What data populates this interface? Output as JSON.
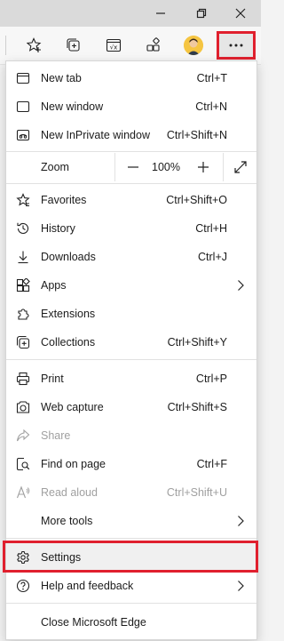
{
  "window": {
    "minimize_icon": "minimize-icon",
    "restore_icon": "restore-icon",
    "close_icon": "close-icon"
  },
  "toolbar": {
    "buttons": [
      "add-favorite-icon",
      "collections-icon",
      "math-solver-icon",
      "extensions-icon",
      "profile-avatar",
      "more-icon"
    ],
    "math_label": "√x"
  },
  "menu": {
    "new_tab": {
      "label": "New tab",
      "shortcut": "Ctrl+T"
    },
    "new_window": {
      "label": "New window",
      "shortcut": "Ctrl+N"
    },
    "new_inprivate": {
      "label": "New InPrivate window",
      "shortcut": "Ctrl+Shift+N"
    },
    "zoom": {
      "label": "Zoom",
      "value": "100%",
      "minus": "—",
      "plus": "+"
    },
    "favorites": {
      "label": "Favorites",
      "shortcut": "Ctrl+Shift+O"
    },
    "history": {
      "label": "History",
      "shortcut": "Ctrl+H"
    },
    "downloads": {
      "label": "Downloads",
      "shortcut": "Ctrl+J"
    },
    "apps": {
      "label": "Apps"
    },
    "extensions": {
      "label": "Extensions"
    },
    "collections": {
      "label": "Collections",
      "shortcut": "Ctrl+Shift+Y"
    },
    "print": {
      "label": "Print",
      "shortcut": "Ctrl+P"
    },
    "web_capture": {
      "label": "Web capture",
      "shortcut": "Ctrl+Shift+S"
    },
    "share": {
      "label": "Share"
    },
    "find_on_page": {
      "label": "Find on page",
      "shortcut": "Ctrl+F"
    },
    "read_aloud": {
      "label": "Read aloud",
      "shortcut": "Ctrl+Shift+U"
    },
    "more_tools": {
      "label": "More tools"
    },
    "settings": {
      "label": "Settings"
    },
    "help_feedback": {
      "label": "Help and feedback"
    },
    "close_edge": {
      "label": "Close Microsoft Edge"
    }
  },
  "colors": {
    "highlight": "#e0202e",
    "menu_bg": "#ffffff",
    "titlebar_bg": "#dadada"
  }
}
